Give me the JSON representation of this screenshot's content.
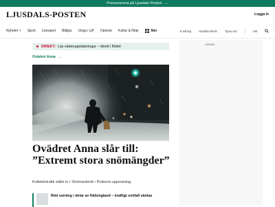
{
  "promo": {
    "text": "Prenumerera på Ljusdals-Posten",
    "arrow": "→"
  },
  "masthead": {
    "logo": "LJUSDALS-POSTEN",
    "login": "Logga in"
  },
  "nav": {
    "items": [
      "Nyheter",
      "Sport",
      "Livesport",
      "Bläljus",
      "Unga i LjP",
      "Opinion",
      "Kultur & Nöje",
      "Mer"
    ],
    "right_items": [
      "E-tidning",
      "Handlarcirkeln",
      "Tipsa oss",
      "Hitt"
    ]
  },
  "ad": {
    "label": "Annons"
  },
  "direkt": {
    "tag": "DIREKT:",
    "text": "Läs väderuppdateringar – direkt i flödet"
  },
  "kicker": {
    "text": "Ovädret Anna",
    "arrow": "→"
  },
  "article": {
    "headline": "Ovädret Anna slår till: ”Extremt stora snömängder”",
    "deck": "Kollektivtrafik ställs in • Strömavbrott • Polisens uppmaning"
  },
  "related": {
    "text": "Röd varning i delar av Hälsingland – kraftigt snöfall väntas"
  },
  "colors": {
    "brand_green": "#0e7a5f",
    "live_red": "#c8102e",
    "direkt_bg": "#e5f1ed"
  }
}
